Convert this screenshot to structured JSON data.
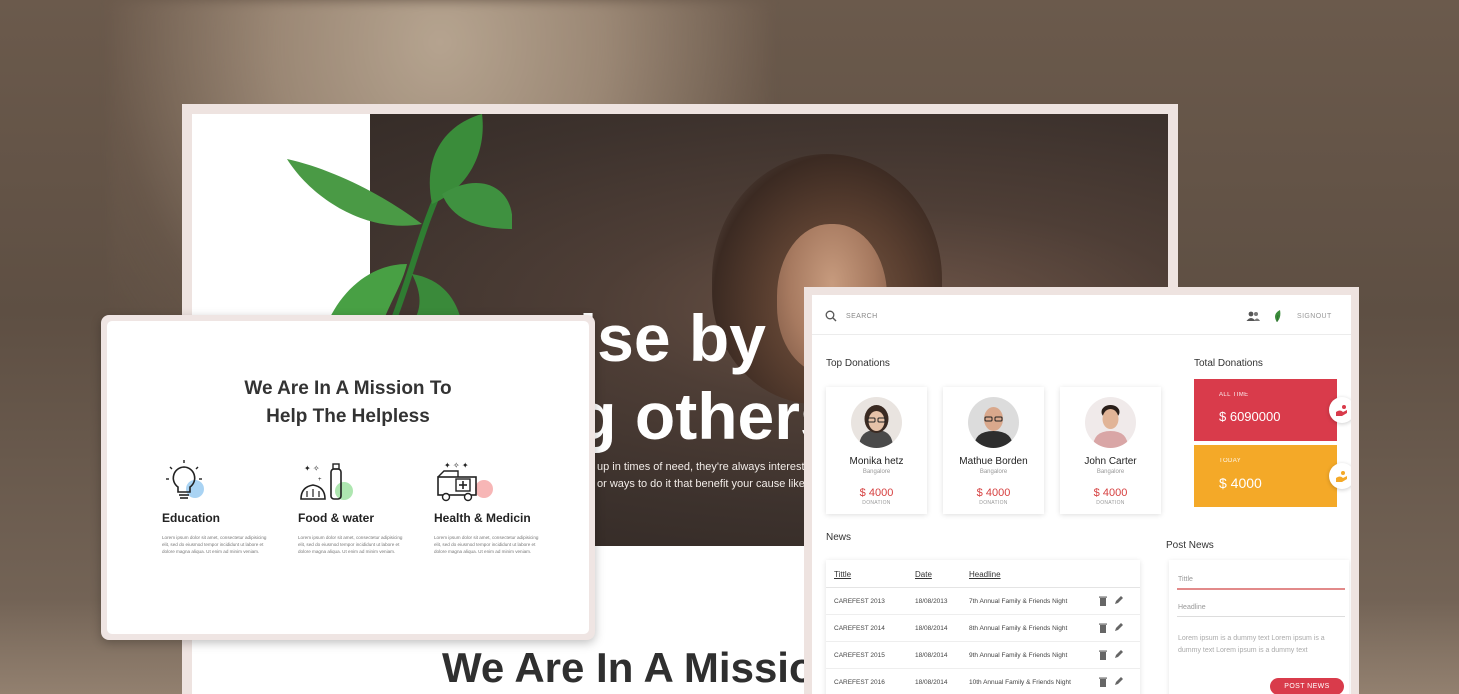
{
  "colors": {
    "accent_red": "#d64040",
    "card_red": "#d93b4b",
    "card_orange": "#f4a928",
    "text_dark": "#333333"
  },
  "landing": {
    "hero_line1": "We rise by",
    "hero_line2": "lifting others",
    "hero_desc_line1": "up in times of need, they're always interested in",
    "hero_desc_line2": "or ways to do it that benefit your cause like.",
    "bottom_title": "We Are In A Mission"
  },
  "mission": {
    "title_line1": "We Are In A Mission To",
    "title_line2": "Help The Helpless",
    "features": [
      {
        "title": "Education",
        "icon": "lightbulb-icon",
        "text": "Lorem ipsum dolor sit amet, consectetur adipisicing elit, sed do eiusmod tempor incididunt ut labore et dolore magna aliqua. Ut enim ad minim veniam."
      },
      {
        "title": "Food & water",
        "icon": "food-water-icon",
        "text": "Lorem ipsum dolor sit amet, consectetur adipisicing elit, sed do eiusmod tempor incididunt ut labore et dolore magna aliqua. Ut enim ad minim veniam."
      },
      {
        "title": "Health & Medicin",
        "icon": "ambulance-icon",
        "text": "Lorem ipsum dolor sit amet, consectetur adipisicing elit, sed do eiusmod tempor incididunt ut labore et dolore magna aliqua. Ut enim ad minim veniam."
      }
    ]
  },
  "dashboard": {
    "search_label": "SEARCH",
    "signout_label": "SIGNOUT",
    "top_donations_title": "Top Donations",
    "total_donations_title": "Total Donations",
    "donors": [
      {
        "name": "Monika hetz",
        "city": "Bangalore",
        "amount": "$ 4000",
        "label": "DONATION"
      },
      {
        "name": "Mathue Borden",
        "city": "Bangalore",
        "amount": "$ 4000",
        "label": "DONATION"
      },
      {
        "name": "John Carter",
        "city": "Bangalore",
        "amount": "$ 4000",
        "label": "DONATION"
      }
    ],
    "totals": [
      {
        "label": "ALL TIME",
        "value": "$ 6090000"
      },
      {
        "label": "TODAY",
        "value": "$ 4000"
      }
    ],
    "news_title": "News",
    "news_headers": [
      "Tittle",
      "Date",
      "Headline"
    ],
    "news_rows": [
      {
        "title": "CAREFEST 2013",
        "date": "18/08/2013",
        "headline": "7th Annual Family & Friends Night"
      },
      {
        "title": "CAREFEST 2014",
        "date": "18/08/2014",
        "headline": "8th Annual Family & Friends Night"
      },
      {
        "title": "CAREFEST 2015",
        "date": "18/08/2014",
        "headline": "9th Annual Family & Friends Night"
      },
      {
        "title": "CAREFEST 2016",
        "date": "18/08/2014",
        "headline": "10th Annual Family & Friends Night"
      }
    ],
    "post_news_title": "Post News",
    "post_form": {
      "title_placeholder": "Tittle",
      "headline_placeholder": "Headline",
      "body_placeholder": "Lorem ipsum is a dummy text Lorem ipsum is a dummy text Lorem ipsum is a dummy text",
      "button_label": "POST NEWS"
    }
  }
}
